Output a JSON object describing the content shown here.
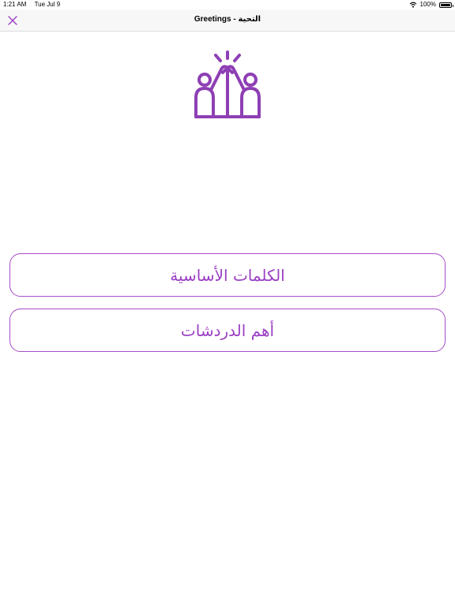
{
  "status_bar": {
    "time": "1:21 AM",
    "date": "Tue Jul 9",
    "battery": "100%",
    "icons": [
      "wifi-icon",
      "battery-icon"
    ]
  },
  "nav": {
    "title": "Greetings - التحية",
    "close_icon": "close-icon"
  },
  "hero": {
    "icon": "high-five-people-icon"
  },
  "menu": {
    "items": [
      {
        "label": "الكلمات الأساسية"
      },
      {
        "label": "أهم الدردشات"
      }
    ]
  },
  "colors": {
    "accent": "#9b3fc4",
    "nav_background": "#f7f7f7"
  }
}
